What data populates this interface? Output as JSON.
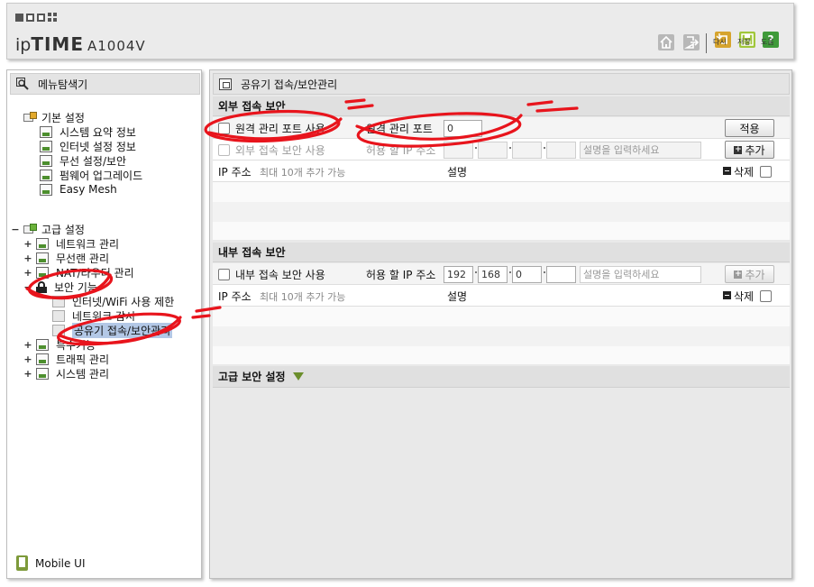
{
  "header": {
    "brand_ip": "ip",
    "brand_time": "TIME",
    "model": "A1004V",
    "actions": {
      "undo": "다시",
      "save": "저장",
      "help": "도움"
    },
    "help_glyph": "?"
  },
  "sidebar": {
    "title": "메뉴탐색기",
    "basic": {
      "label": "기본 설정",
      "items": [
        "시스템 요약 정보",
        "인터넷 설정 정보",
        "무선 설정/보안",
        "펌웨어 업그레이드",
        "Easy Mesh"
      ]
    },
    "advanced": {
      "label": "고급 설정",
      "items": [
        "네트워크 관리",
        "무선랜 관리",
        "NAT/라우터 관리",
        "보안 기능",
        "특수기능",
        "트래픽 관리",
        "시스템 관리"
      ],
      "security_children": [
        "인터넷/WiFi 사용 제한",
        "네트워크 감시",
        "공유기 접속/보안관리"
      ]
    },
    "expander_plus": "+",
    "expander_minus": "−",
    "mobile_ui": "Mobile UI"
  },
  "main": {
    "title": "공유기 접속/보안관리",
    "external": {
      "section": "외부 접속 보안",
      "remote_port_use": "원격 관리 포트 사용",
      "remote_port_label": "원격 관리 포트",
      "remote_port_value": "0",
      "apply": "적용",
      "ext_security_use": "외부 접속 보안 사용",
      "allowed_ip_label": "허용 할 IP 주소",
      "desc_placeholder": "설명을 입력하세요",
      "add": "추가",
      "col_ip": "IP 주소",
      "col_hint": "최대 10개 추가 가능",
      "col_desc": "설명",
      "delete": "삭제"
    },
    "internal": {
      "section": "내부 접속 보안",
      "int_security_use": "내부 접속 보안 사용",
      "allowed_ip_label": "허용 할 IP 주소",
      "ip1": "192",
      "ip2": "168",
      "ip3": "0",
      "desc_placeholder": "설명을 입력하세요",
      "add": "추가",
      "col_ip": "IP 주소",
      "col_hint": "최대 10개 추가 가능",
      "col_desc": "설명",
      "delete": "삭제"
    },
    "advanced_section": "고급 보안 설정"
  },
  "colors": {
    "annotation_red": "#e8141c",
    "undo_icon": "#d6a42e",
    "save_icon": "#a0c63a",
    "help_icon": "#3f9a3a",
    "selected_highlight": "#b3c8e6",
    "advanced_triangle": "#6b8e2b"
  },
  "icons": [
    "home-icon",
    "logout-icon",
    "undo-icon",
    "save-icon",
    "help-icon",
    "search-icon",
    "folder-icon",
    "lock-icon",
    "mobile-icon",
    "delete-icon",
    "plus-icon",
    "dropdown-triangle-icon"
  ]
}
